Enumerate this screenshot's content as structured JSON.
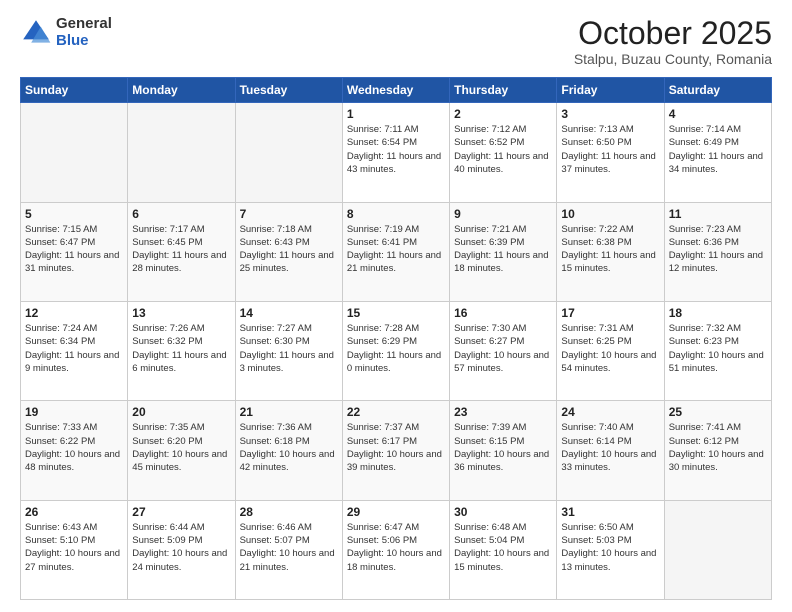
{
  "logo": {
    "general": "General",
    "blue": "Blue"
  },
  "header": {
    "month": "October 2025",
    "location": "Stalpu, Buzau County, Romania"
  },
  "weekdays": [
    "Sunday",
    "Monday",
    "Tuesday",
    "Wednesday",
    "Thursday",
    "Friday",
    "Saturday"
  ],
  "weeks": [
    [
      {
        "day": "",
        "sunrise": "",
        "sunset": "",
        "daylight": "",
        "empty": true
      },
      {
        "day": "",
        "sunrise": "",
        "sunset": "",
        "daylight": "",
        "empty": true
      },
      {
        "day": "",
        "sunrise": "",
        "sunset": "",
        "daylight": "",
        "empty": true
      },
      {
        "day": "1",
        "sunrise": "Sunrise: 7:11 AM",
        "sunset": "Sunset: 6:54 PM",
        "daylight": "Daylight: 11 hours and 43 minutes.",
        "empty": false
      },
      {
        "day": "2",
        "sunrise": "Sunrise: 7:12 AM",
        "sunset": "Sunset: 6:52 PM",
        "daylight": "Daylight: 11 hours and 40 minutes.",
        "empty": false
      },
      {
        "day": "3",
        "sunrise": "Sunrise: 7:13 AM",
        "sunset": "Sunset: 6:50 PM",
        "daylight": "Daylight: 11 hours and 37 minutes.",
        "empty": false
      },
      {
        "day": "4",
        "sunrise": "Sunrise: 7:14 AM",
        "sunset": "Sunset: 6:49 PM",
        "daylight": "Daylight: 11 hours and 34 minutes.",
        "empty": false
      }
    ],
    [
      {
        "day": "5",
        "sunrise": "Sunrise: 7:15 AM",
        "sunset": "Sunset: 6:47 PM",
        "daylight": "Daylight: 11 hours and 31 minutes.",
        "empty": false
      },
      {
        "day": "6",
        "sunrise": "Sunrise: 7:17 AM",
        "sunset": "Sunset: 6:45 PM",
        "daylight": "Daylight: 11 hours and 28 minutes.",
        "empty": false
      },
      {
        "day": "7",
        "sunrise": "Sunrise: 7:18 AM",
        "sunset": "Sunset: 6:43 PM",
        "daylight": "Daylight: 11 hours and 25 minutes.",
        "empty": false
      },
      {
        "day": "8",
        "sunrise": "Sunrise: 7:19 AM",
        "sunset": "Sunset: 6:41 PM",
        "daylight": "Daylight: 11 hours and 21 minutes.",
        "empty": false
      },
      {
        "day": "9",
        "sunrise": "Sunrise: 7:21 AM",
        "sunset": "Sunset: 6:39 PM",
        "daylight": "Daylight: 11 hours and 18 minutes.",
        "empty": false
      },
      {
        "day": "10",
        "sunrise": "Sunrise: 7:22 AM",
        "sunset": "Sunset: 6:38 PM",
        "daylight": "Daylight: 11 hours and 15 minutes.",
        "empty": false
      },
      {
        "day": "11",
        "sunrise": "Sunrise: 7:23 AM",
        "sunset": "Sunset: 6:36 PM",
        "daylight": "Daylight: 11 hours and 12 minutes.",
        "empty": false
      }
    ],
    [
      {
        "day": "12",
        "sunrise": "Sunrise: 7:24 AM",
        "sunset": "Sunset: 6:34 PM",
        "daylight": "Daylight: 11 hours and 9 minutes.",
        "empty": false
      },
      {
        "day": "13",
        "sunrise": "Sunrise: 7:26 AM",
        "sunset": "Sunset: 6:32 PM",
        "daylight": "Daylight: 11 hours and 6 minutes.",
        "empty": false
      },
      {
        "day": "14",
        "sunrise": "Sunrise: 7:27 AM",
        "sunset": "Sunset: 6:30 PM",
        "daylight": "Daylight: 11 hours and 3 minutes.",
        "empty": false
      },
      {
        "day": "15",
        "sunrise": "Sunrise: 7:28 AM",
        "sunset": "Sunset: 6:29 PM",
        "daylight": "Daylight: 11 hours and 0 minutes.",
        "empty": false
      },
      {
        "day": "16",
        "sunrise": "Sunrise: 7:30 AM",
        "sunset": "Sunset: 6:27 PM",
        "daylight": "Daylight: 10 hours and 57 minutes.",
        "empty": false
      },
      {
        "day": "17",
        "sunrise": "Sunrise: 7:31 AM",
        "sunset": "Sunset: 6:25 PM",
        "daylight": "Daylight: 10 hours and 54 minutes.",
        "empty": false
      },
      {
        "day": "18",
        "sunrise": "Sunrise: 7:32 AM",
        "sunset": "Sunset: 6:23 PM",
        "daylight": "Daylight: 10 hours and 51 minutes.",
        "empty": false
      }
    ],
    [
      {
        "day": "19",
        "sunrise": "Sunrise: 7:33 AM",
        "sunset": "Sunset: 6:22 PM",
        "daylight": "Daylight: 10 hours and 48 minutes.",
        "empty": false
      },
      {
        "day": "20",
        "sunrise": "Sunrise: 7:35 AM",
        "sunset": "Sunset: 6:20 PM",
        "daylight": "Daylight: 10 hours and 45 minutes.",
        "empty": false
      },
      {
        "day": "21",
        "sunrise": "Sunrise: 7:36 AM",
        "sunset": "Sunset: 6:18 PM",
        "daylight": "Daylight: 10 hours and 42 minutes.",
        "empty": false
      },
      {
        "day": "22",
        "sunrise": "Sunrise: 7:37 AM",
        "sunset": "Sunset: 6:17 PM",
        "daylight": "Daylight: 10 hours and 39 minutes.",
        "empty": false
      },
      {
        "day": "23",
        "sunrise": "Sunrise: 7:39 AM",
        "sunset": "Sunset: 6:15 PM",
        "daylight": "Daylight: 10 hours and 36 minutes.",
        "empty": false
      },
      {
        "day": "24",
        "sunrise": "Sunrise: 7:40 AM",
        "sunset": "Sunset: 6:14 PM",
        "daylight": "Daylight: 10 hours and 33 minutes.",
        "empty": false
      },
      {
        "day": "25",
        "sunrise": "Sunrise: 7:41 AM",
        "sunset": "Sunset: 6:12 PM",
        "daylight": "Daylight: 10 hours and 30 minutes.",
        "empty": false
      }
    ],
    [
      {
        "day": "26",
        "sunrise": "Sunrise: 6:43 AM",
        "sunset": "Sunset: 5:10 PM",
        "daylight": "Daylight: 10 hours and 27 minutes.",
        "empty": false
      },
      {
        "day": "27",
        "sunrise": "Sunrise: 6:44 AM",
        "sunset": "Sunset: 5:09 PM",
        "daylight": "Daylight: 10 hours and 24 minutes.",
        "empty": false
      },
      {
        "day": "28",
        "sunrise": "Sunrise: 6:46 AM",
        "sunset": "Sunset: 5:07 PM",
        "daylight": "Daylight: 10 hours and 21 minutes.",
        "empty": false
      },
      {
        "day": "29",
        "sunrise": "Sunrise: 6:47 AM",
        "sunset": "Sunset: 5:06 PM",
        "daylight": "Daylight: 10 hours and 18 minutes.",
        "empty": false
      },
      {
        "day": "30",
        "sunrise": "Sunrise: 6:48 AM",
        "sunset": "Sunset: 5:04 PM",
        "daylight": "Daylight: 10 hours and 15 minutes.",
        "empty": false
      },
      {
        "day": "31",
        "sunrise": "Sunrise: 6:50 AM",
        "sunset": "Sunset: 5:03 PM",
        "daylight": "Daylight: 10 hours and 13 minutes.",
        "empty": false
      },
      {
        "day": "",
        "sunrise": "",
        "sunset": "",
        "daylight": "",
        "empty": true
      }
    ]
  ]
}
